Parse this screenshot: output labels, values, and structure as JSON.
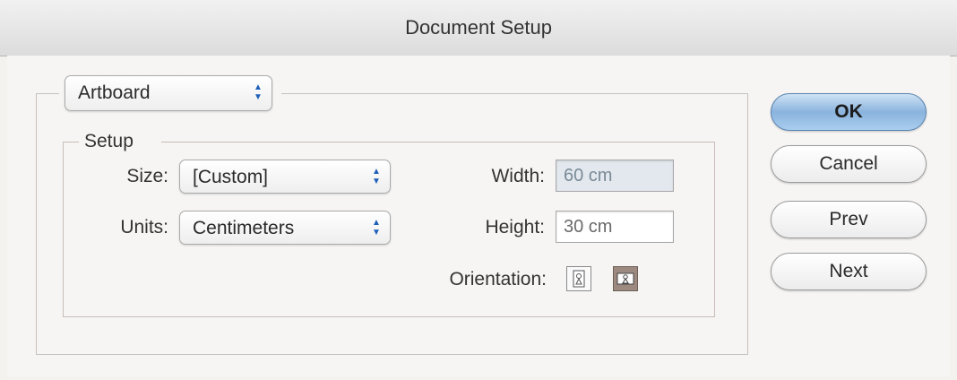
{
  "window": {
    "title": "Document Setup"
  },
  "panel_select": {
    "value": "Artboard"
  },
  "setup": {
    "legend": "Setup",
    "size": {
      "label": "Size:",
      "value": "[Custom]"
    },
    "units": {
      "label": "Units:",
      "value": "Centimeters"
    },
    "width": {
      "label": "Width:",
      "value": "60 cm"
    },
    "height": {
      "label": "Height:",
      "value": "30 cm"
    },
    "orientation": {
      "label": "Orientation:",
      "selected": "landscape"
    }
  },
  "buttons": {
    "ok": "OK",
    "cancel": "Cancel",
    "prev": "Prev",
    "next": "Next"
  },
  "colors": {
    "default_button": "#8ab3dd",
    "stepper_arrows": "#1d5fb8"
  }
}
